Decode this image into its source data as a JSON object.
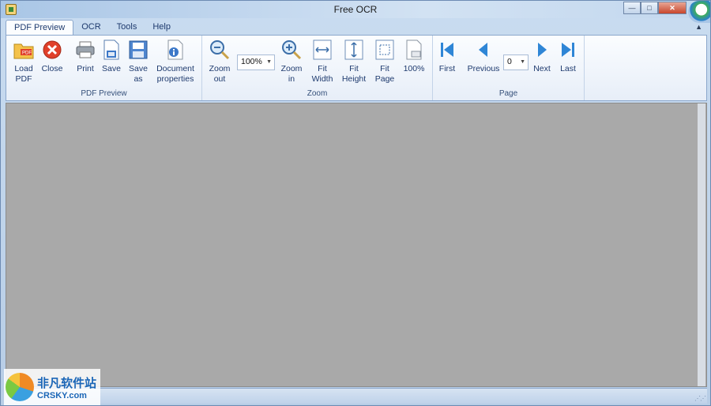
{
  "window": {
    "title": "Free OCR",
    "controls": {
      "minimize": "—",
      "maximize": "□",
      "close": "✕"
    }
  },
  "tabs": [
    {
      "label": "PDF Preview",
      "active": true
    },
    {
      "label": "OCR",
      "active": false
    },
    {
      "label": "Tools",
      "active": false
    },
    {
      "label": "Help",
      "active": false
    }
  ],
  "ribbon": {
    "groups": {
      "pdf_preview": {
        "label": "PDF Preview",
        "buttons": {
          "load_pdf": "Load\nPDF",
          "close": "Close",
          "print": "Print",
          "save": "Save",
          "save_as": "Save\nas",
          "document_properties": "Document\nproperties"
        }
      },
      "zoom": {
        "label": "Zoom",
        "zoom_value": "100%",
        "buttons": {
          "zoom_out": "Zoom\nout",
          "zoom_in": "Zoom\nin",
          "fit_width": "Fit\nWidth",
          "fit_height": "Fit\nHeight",
          "fit_page": "Fit\nPage",
          "actual_size": "100%"
        }
      },
      "page": {
        "label": "Page",
        "page_value": "0",
        "buttons": {
          "first": "First",
          "previous": "Previous",
          "next": "Next",
          "last": "Last"
        }
      }
    }
  },
  "watermark": {
    "cn": "非凡软件站",
    "en": "CRSKY.com"
  },
  "colors": {
    "ribbon_text": "#1e3a6e",
    "content_bg": "#a9a9a9",
    "nav_blue": "#2f86d6",
    "close_red": "#e0402a"
  },
  "icons": {
    "load_pdf": "folder-pdf-icon",
    "close": "close-circle-icon",
    "print": "printer-icon",
    "save": "save-icon",
    "save_as": "save-as-icon",
    "document_properties": "document-info-icon",
    "zoom_out": "zoom-out-icon",
    "zoom_in": "zoom-in-icon",
    "fit_width": "fit-width-icon",
    "fit_height": "fit-height-icon",
    "fit_page": "fit-page-icon",
    "actual_size": "actual-size-icon",
    "first": "first-page-icon",
    "previous": "previous-page-icon",
    "next": "next-page-icon",
    "last": "last-page-icon"
  }
}
